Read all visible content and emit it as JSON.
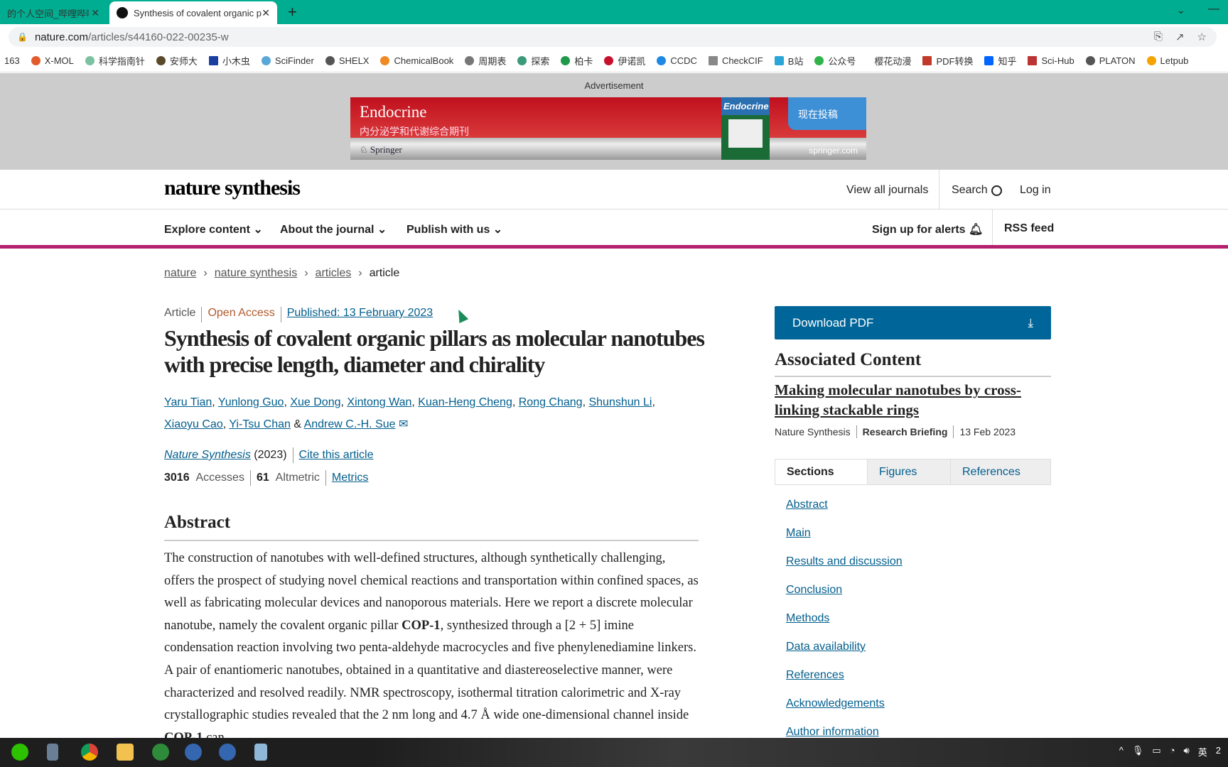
{
  "browser": {
    "tabs": [
      {
        "label": "的个人空间_哔哩哔哩_",
        "active": false
      },
      {
        "label": "Synthesis of covalent organic p",
        "active": true
      }
    ],
    "new_tab": "+",
    "url_host": "nature.com",
    "url_path": "/articles/s44160-022-00235-w",
    "bookmarks": [
      "163",
      "X-MOL",
      "科学指南针",
      "安师大",
      "小木虫",
      "SciFinder",
      "SHELX",
      "ChemicalBook",
      "周期表",
      "探索",
      "柏卡",
      "伊诺凯",
      "CCDC",
      "CheckCIF",
      "B站",
      "公众号",
      "樱花动漫",
      "PDF转换",
      "知乎",
      "Sci-Hub",
      "PLATON",
      "Letpub"
    ]
  },
  "ad": {
    "label": "Advertisement",
    "title": "Endocrine",
    "subtitle": "内分泌学和代谢综合期刊",
    "publisher": "Springer",
    "cover_title": "Endocrine",
    "cta": "现在投稿",
    "site": "springer.com"
  },
  "header": {
    "logo": "nature synthesis",
    "view_all": "View all journals",
    "search": "Search",
    "login": "Log in"
  },
  "nav": {
    "explore": "Explore content",
    "about": "About the journal",
    "publish": "Publish with us",
    "alerts": "Sign up for alerts",
    "rss": "RSS feed"
  },
  "breadcrumb": [
    "nature",
    "nature synthesis",
    "articles",
    "article"
  ],
  "article": {
    "type": "Article",
    "access": "Open Access",
    "published": "Published: 13 February 2023",
    "title": "Synthesis of covalent organic pillars as molecular nanotubes with precise length, diameter and chirality",
    "authors": [
      "Yaru Tian",
      "Yunlong Guo",
      "Xue Dong",
      "Xintong Wan",
      "Kuan-Heng Cheng",
      "Rong Chang",
      "Shunshun Li",
      "Xiaoyu Cao",
      "Yi-Tsu Chan",
      "Andrew C.-H. Sue"
    ],
    "journal": "Nature Synthesis",
    "year": "(2023)",
    "cite": "Cite this article",
    "accesses": "3016",
    "accesses_label": "Accesses",
    "altmetric": "61",
    "altmetric_label": "Altmetric",
    "metrics": "Metrics",
    "abstract_heading": "Abstract",
    "abstract_1": "The construction of nanotubes with well-defined structures, although synthetically challenging, offers the prospect of studying novel chemical reactions and transportation within confined spaces, as well as fabricating molecular devices and nanoporous materials. Here we report a discrete molecular nanotube, namely the covalent organic pillar ",
    "cop": "COP-1",
    "abstract_2": ", synthesized through a [2 + 5] imine condensation reaction involving two penta-aldehyde macrocycles and five phenylenediamine linkers. A pair of enantiomeric nanotubes, obtained in a quantitative and diastereoselective manner, were characterized and resolved readily. NMR spectroscopy, isothermal titration calorimetric and X-ray crystallographic studies revealed that the 2 nm long and 4.7 Å wide one-dimensional channel inside ",
    "abstract_3": " can"
  },
  "sidebar": {
    "download": "Download PDF",
    "assoc_heading": "Associated Content",
    "assoc_title": "Making molecular nanotubes by cross-linking stackable rings",
    "assoc_journal": "Nature Synthesis",
    "assoc_type": "Research Briefing",
    "assoc_date": "13 Feb 2023",
    "tabs": [
      "Sections",
      "Figures",
      "References"
    ],
    "sections": [
      "Abstract",
      "Main",
      "Results and discussion",
      "Conclusion",
      "Methods",
      "Data availability",
      "References",
      "Acknowledgements",
      "Author information"
    ]
  },
  "taskbar": {
    "ime": "英",
    "clock": "2"
  },
  "colors": {
    "tabbar": "#00ad90",
    "accent_magenta": "#b3206f",
    "link": "#025e8d",
    "download": "#006699",
    "open_access": "#b05a2e"
  }
}
